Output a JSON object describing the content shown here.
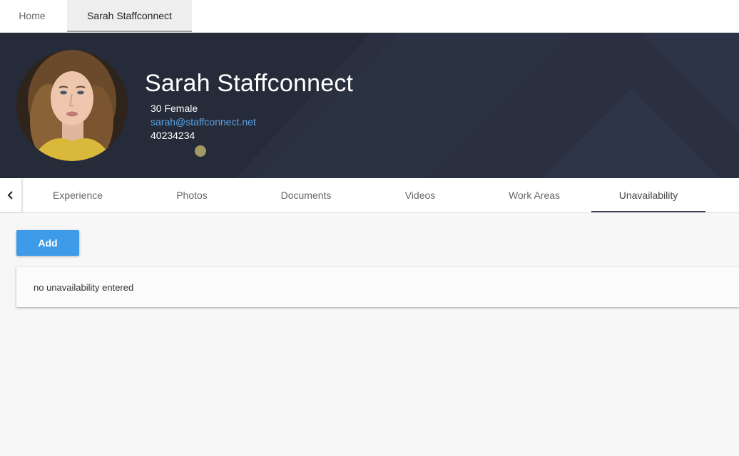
{
  "top_tabs": [
    {
      "label": "Home",
      "active": false
    },
    {
      "label": "Sarah Staffconnect",
      "active": true
    }
  ],
  "profile": {
    "name": "Sarah Staffconnect",
    "age_gender": "30 Female",
    "email": "sarah@staffconnect.net",
    "phone": "40234234"
  },
  "tabs": [
    {
      "label": "Experience",
      "active": false
    },
    {
      "label": "Photos",
      "active": false
    },
    {
      "label": "Documents",
      "active": false
    },
    {
      "label": "Videos",
      "active": false
    },
    {
      "label": "Work Areas",
      "active": false
    },
    {
      "label": "Unavailability",
      "active": true
    }
  ],
  "content": {
    "add_label": "Add",
    "empty_message": "no unavailability entered"
  },
  "colors": {
    "hero_bg": "#262b3a",
    "accent": "#3d9be9",
    "link": "#5aa3e6"
  }
}
